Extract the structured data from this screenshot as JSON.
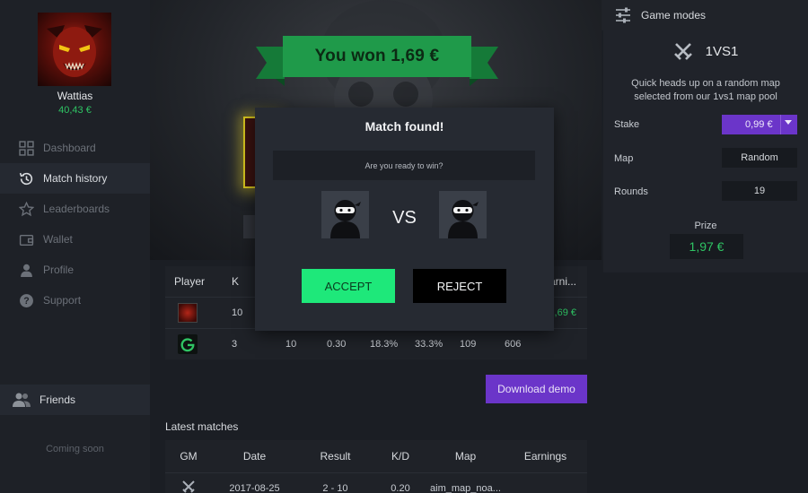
{
  "user": {
    "name": "Wattias",
    "balance": "40,43 €"
  },
  "nav": {
    "items": [
      {
        "label": "Dashboard",
        "icon": "grid-icon"
      },
      {
        "label": "Match history",
        "icon": "history-icon"
      },
      {
        "label": "Leaderboards",
        "icon": "star-icon"
      },
      {
        "label": "Wallet",
        "icon": "wallet-icon"
      },
      {
        "label": "Profile",
        "icon": "user-icon"
      },
      {
        "label": "Support",
        "icon": "help-icon"
      }
    ],
    "active": "Match history"
  },
  "friends": {
    "label": "Friends",
    "coming_soon": "Coming soon"
  },
  "hero": {
    "win_text": "You won 1,69 €"
  },
  "stats": {
    "headers": {
      "player": "Player",
      "k": "K",
      "earnings": "Earni..."
    },
    "rows": [
      {
        "k": "10",
        "earnings": "1,69 €"
      },
      {
        "k": "3",
        "v1": "10",
        "v2": "0.30",
        "v3": "18.3%",
        "v4": "33.3%",
        "v5": "109",
        "v6": "606"
      }
    ]
  },
  "download_label": "Download demo",
  "latest": {
    "title": "Latest matches",
    "headers": [
      "GM",
      "Date",
      "Result",
      "K/D",
      "Map",
      "Earnings"
    ],
    "rows": [
      {
        "date": "2017-08-25",
        "result": "2 - 10",
        "kd": "0.20",
        "map": "aim_map_noa..."
      }
    ]
  },
  "modal": {
    "title": "Match found!",
    "question": "Are you ready to win?",
    "vs": "VS",
    "accept": "ACCEPT",
    "reject": "REJECT"
  },
  "right_panel": {
    "header": "Game modes",
    "mode": "1VS1",
    "description": "Quick heads up on a random map selected from our 1vs1 map pool",
    "stake_label": "Stake",
    "stake_value": "0,99 €",
    "map_label": "Map",
    "map_value": "Random",
    "rounds_label": "Rounds",
    "rounds_value": "19",
    "prize_label": "Prize",
    "prize_value": "1,97 €"
  },
  "colors": {
    "accent_green": "#2fc464",
    "accept_green": "#1ee87a",
    "purple": "#6b35c9",
    "banner_green": "#1f9a4a"
  }
}
